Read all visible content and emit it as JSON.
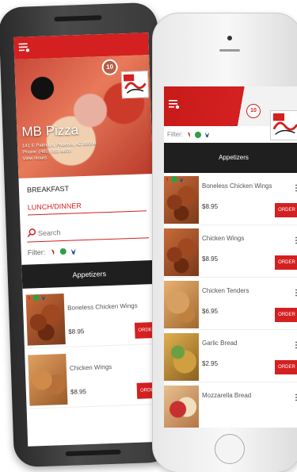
{
  "colors": {
    "brand_red": "#d42020",
    "section_dark": "#1f1f1f"
  },
  "android": {
    "cart_count": "10",
    "restaurant_name": "MB Pizza",
    "address_line1": "141 E Palm Ln, Phoenix, AZ 85004",
    "phone": "Phone: (480) 351-8800",
    "hours_link": "View Hours",
    "menu_sections": [
      "BREAKFAST",
      "LUNCH/DINNER"
    ],
    "search_placeholder": "Search",
    "filter_label": "Filter:",
    "category": "Appetizers",
    "items": [
      {
        "title": "Boneless Chicken Wings",
        "price": "$8.95",
        "order_label": "ORDER"
      },
      {
        "title": "Chicken Wings",
        "price": "$8.95",
        "order_label": "ORDER"
      }
    ]
  },
  "iphone": {
    "cart_count": "10",
    "filter_label": "Filter:",
    "category": "Appetizers",
    "items": [
      {
        "title": "Boneless Chicken Wings",
        "price": "$8.95",
        "order_label": "ORDER"
      },
      {
        "title": "Chicken Wings",
        "price": "$8.95",
        "order_label": "ORDER"
      },
      {
        "title": "Chicken Tenders",
        "price": "$6.95",
        "order_label": "ORDER"
      },
      {
        "title": "Garlic Bread",
        "price": "$2.95",
        "order_label": "ORDER"
      },
      {
        "title": "Mozzarella Bread",
        "price": "",
        "order_label": ""
      }
    ]
  },
  "icons": {
    "menu": "hamburger-menu-icon",
    "search": "search-icon",
    "filter_spicy": "chili-pepper-icon",
    "filter_vegetarian": "vegetarian-leaf-icon",
    "filter_chicken": "chicken-icon",
    "more": "kebab-menu-icon",
    "logo": "mb-pizza-logo"
  }
}
